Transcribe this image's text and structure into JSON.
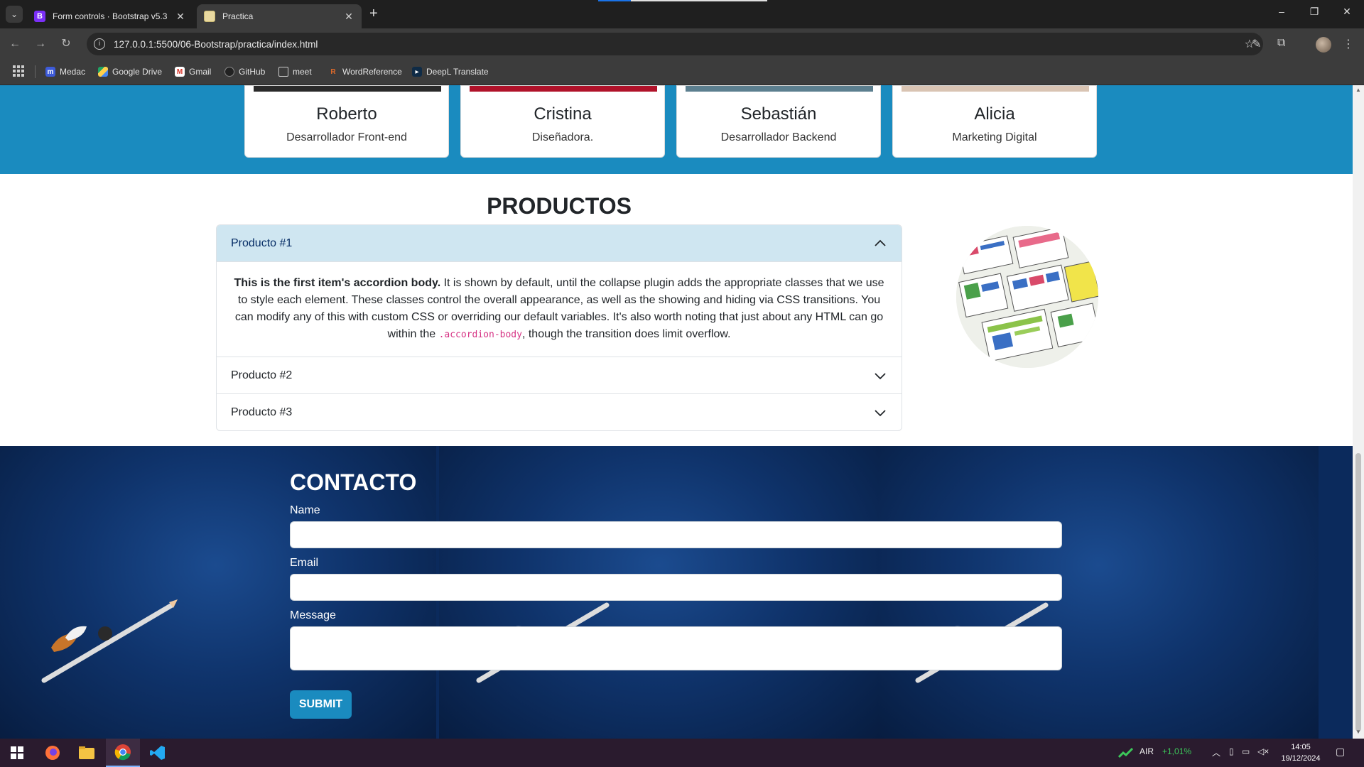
{
  "browser": {
    "tabs": [
      {
        "title": "Form controls · Bootstrap v5.3",
        "favicon": "B",
        "active": false
      },
      {
        "title": "Practica",
        "active": true
      }
    ],
    "url": "127.0.0.1:5500/06-Bootstrap/practica/index.html",
    "bookmarks": [
      "Medac",
      "Google Drive",
      "Gmail",
      "GitHub",
      "meet",
      "WordReference",
      "DeepL Translate"
    ]
  },
  "team": {
    "members": [
      {
        "name": "Roberto",
        "role": "Desarrollador Front-end"
      },
      {
        "name": "Cristina",
        "role": "Diseñadora."
      },
      {
        "name": "Sebastián",
        "role": "Desarrollador Backend"
      },
      {
        "name": "Alicia",
        "role": "Marketing Digital"
      }
    ]
  },
  "productos": {
    "title": "PRODUCTOS",
    "items": [
      {
        "label": "Producto #1",
        "open": true,
        "body_bold": "This is the first item's accordion body.",
        "body_text": " It is shown by default, until the collapse plugin adds the appropriate classes that we use to style each element. These classes control the overall appearance, as well as the showing and hiding via CSS transitions. You can modify any of this with custom CSS or overriding our default variables. It's also worth noting that just about any HTML can go within the ",
        "body_code": ".accordion-body",
        "body_tail": ", though the transition does limit overflow."
      },
      {
        "label": "Producto #2",
        "open": false
      },
      {
        "label": "Producto #3",
        "open": false
      }
    ]
  },
  "contacto": {
    "title": "CONTACTO",
    "name_label": "Name",
    "email_label": "Email",
    "message_label": "Message",
    "submit_label": "SUBMIT"
  },
  "taskbar": {
    "weather_label": "AIR",
    "weather_change": "+1,01%",
    "time": "14:05",
    "date": "19/12/2024"
  },
  "colors": {
    "team_bg": "#1a8bbf",
    "accordion_open_bg": "#cfe6f1",
    "contact_bg": "#0b2a5c",
    "submit_bg": "#1a8bbf"
  }
}
